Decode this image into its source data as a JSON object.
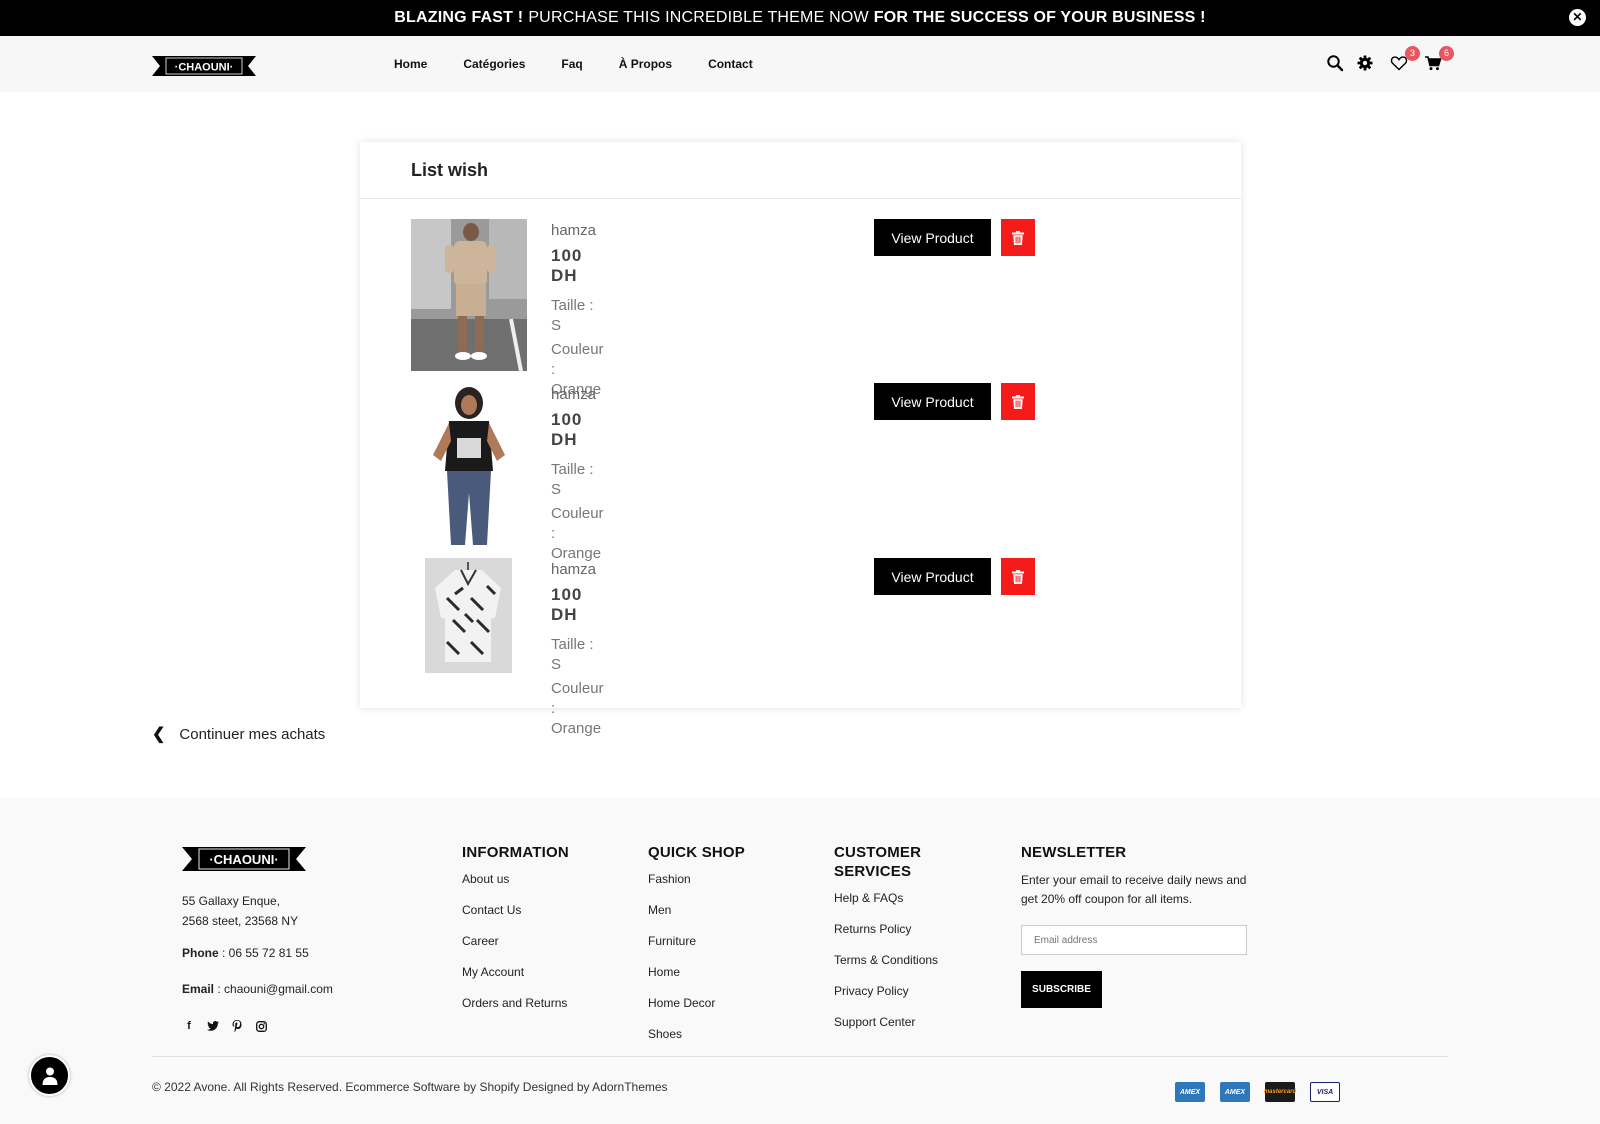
{
  "announcement": {
    "part1": "BLAZING FAST !",
    "part2": "PURCHASE THIS INCREDIBLE THEME NOW",
    "part3": "FOR THE SUCCESS OF YOUR BUSINESS !"
  },
  "brand": {
    "name": "CHAOUNI"
  },
  "nav": [
    "Home",
    "Catégories",
    "Faq",
    "À Propos",
    "Contact"
  ],
  "header": {
    "wishlist_count": "3",
    "cart_count": "6"
  },
  "wishlist": {
    "title": "List wish",
    "view_label": "View Product",
    "items": [
      {
        "name": "hamza",
        "price": "100  DH",
        "size": "Taille : S",
        "color": "Couleur : Orange",
        "image": "man-beige-outfit"
      },
      {
        "name": "hamza",
        "price": "100  DH",
        "size": "Taille : S",
        "color": "Couleur : Orange",
        "image": "woman-black-tshirt"
      },
      {
        "name": "hamza",
        "price": "100  DH",
        "size": "Taille : S",
        "color": "Couleur : Orange",
        "image": "patterned-shirt"
      }
    ]
  },
  "continue_label": "Continuer mes achats",
  "footer": {
    "address_line1": "55 Gallaxy Enque,",
    "address_line2": "2568 steet, 23568 NY",
    "phone_label": "Phone",
    "phone": " : 06 55 72 81 55",
    "email_label": "Email",
    "email": " : chaouni@gmail.com",
    "social": [
      "facebook-icon",
      "twitter-icon",
      "pinterest-icon",
      "instagram-icon"
    ],
    "information": {
      "title": "INFORMATION",
      "links": [
        "About us",
        "Contact Us",
        "Career",
        "My Account",
        "Orders and Returns"
      ]
    },
    "quick_shop": {
      "title": "QUICK SHOP",
      "links": [
        "Fashion",
        "Men",
        "Furniture",
        "Home",
        "Home Decor",
        "Shoes"
      ]
    },
    "customer": {
      "title_line1": "CUSTOMER",
      "title_line2": "SERVICES",
      "links": [
        "Help & FAQs",
        "Returns Policy",
        "Terms & Conditions",
        "Privacy Policy",
        "Support Center"
      ]
    },
    "newsletter": {
      "title": "NEWSLETTER",
      "text": "Enter your email to receive daily news and get 20% off coupon for all items.",
      "placeholder": "Email address",
      "button": "SUBSCRIBE"
    },
    "copyright": "© 2022 Avone. All Rights Reserved. Ecommerce Software by Shopify Designed by AdornThemes",
    "payments": [
      "AMEX",
      "AMEX",
      "mastercard",
      "VISA"
    ]
  },
  "colors": {
    "accent_red": "#f51b1b",
    "badge": "#e8575f",
    "black": "#000000"
  }
}
